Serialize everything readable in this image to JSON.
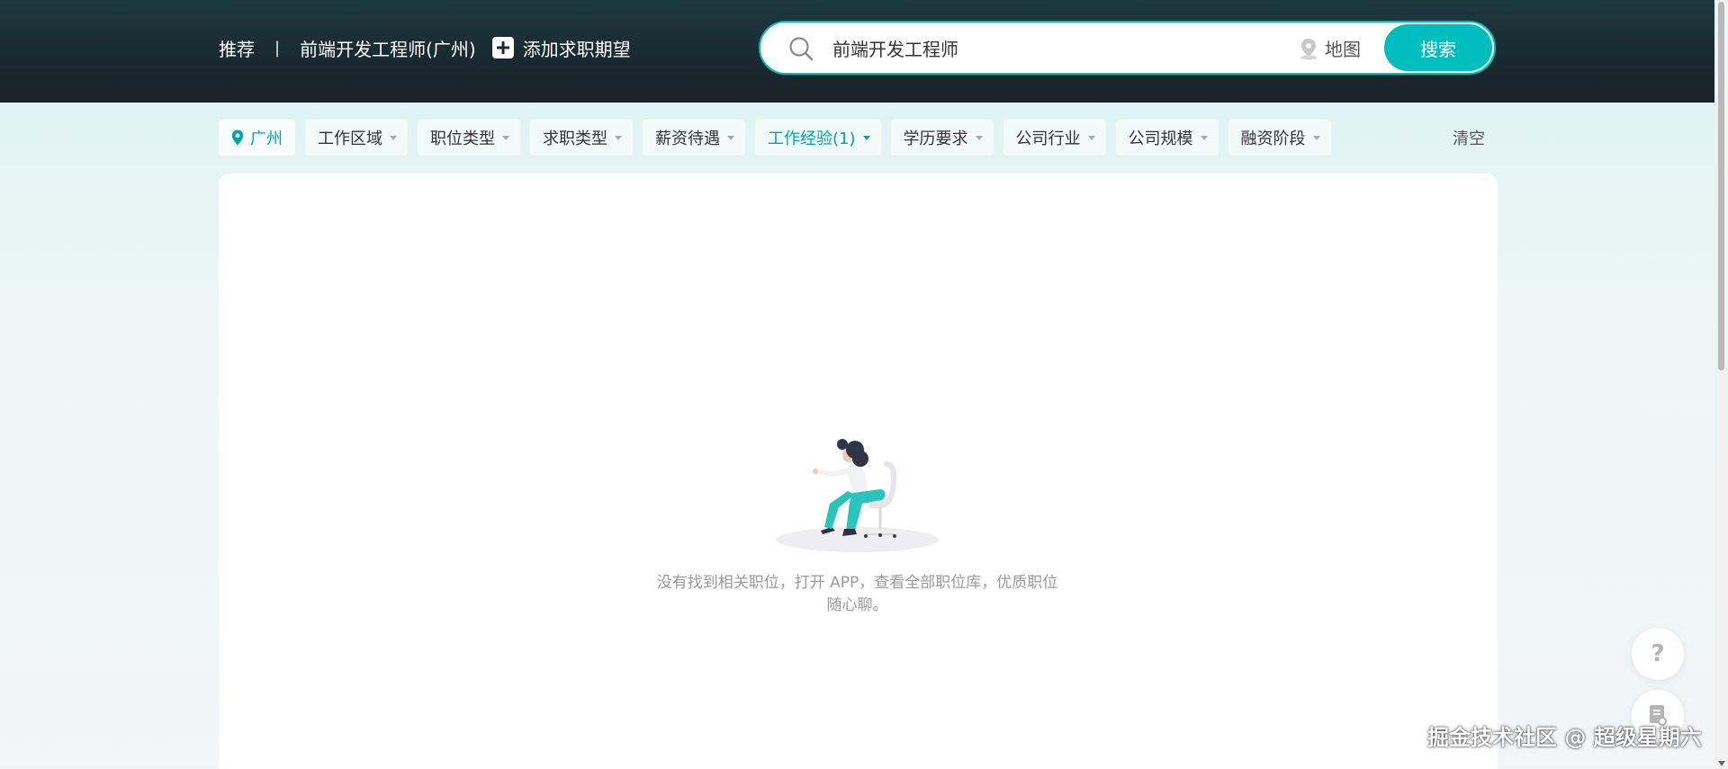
{
  "header": {
    "nav": {
      "recommend": "推荐",
      "separator": "|",
      "expectation": "前端开发工程师(广州)",
      "add_expectation": "添加求职期望"
    },
    "search": {
      "value": "前端开发工程师",
      "map_label": "地图",
      "button_label": "搜索"
    }
  },
  "filters": {
    "city": "广州",
    "items": [
      "工作区域",
      "职位类型",
      "求职类型",
      "薪资待遇",
      "工作经验(1)",
      "学历要求",
      "公司行业",
      "公司规模",
      "融资阶段"
    ],
    "active_item": "工作经验(1)",
    "clear_label": "清空"
  },
  "empty_state": {
    "text": "没有找到相关职位，打开 APP，查看全部职位库，优质职位随心聊。"
  },
  "floating": {
    "help_glyph": "?",
    "help_icon": "question-icon",
    "doc_icon": "resume-icon"
  },
  "watermark": "掘金技术社区 @ 超级星期六",
  "colors": {
    "accent": "#00bebd",
    "header_bg": "#1a2a31",
    "active_filter": "#00a6a7"
  }
}
